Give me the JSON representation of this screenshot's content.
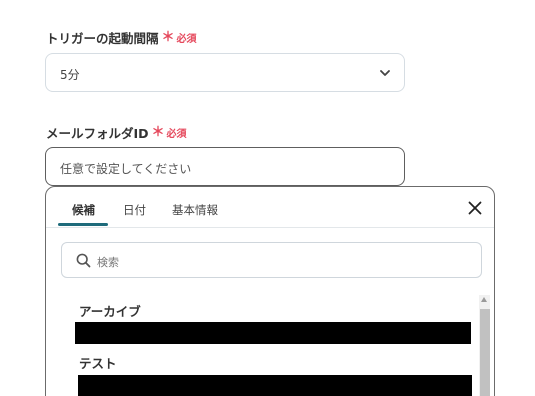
{
  "trigger_interval": {
    "label": "トリガーの起動間隔",
    "required_mark": "＊",
    "required_text": "必須",
    "value": "5分"
  },
  "mail_folder": {
    "label": "メールフォルダID",
    "required_mark": "＊",
    "required_text": "必須",
    "placeholder": "任意で設定してください"
  },
  "picker": {
    "tabs": [
      {
        "label": "候補",
        "active": true
      },
      {
        "label": "日付",
        "active": false
      },
      {
        "label": "基本情報",
        "active": false
      }
    ],
    "search_placeholder": "検索",
    "items": [
      {
        "label": "アーカイブ"
      },
      {
        "label": "テスト"
      }
    ]
  },
  "colors": {
    "required": "#e5475b",
    "tab_active": "#1e6b7b"
  },
  "icons": [
    "chevron-down-icon",
    "close-icon",
    "search-icon"
  ]
}
